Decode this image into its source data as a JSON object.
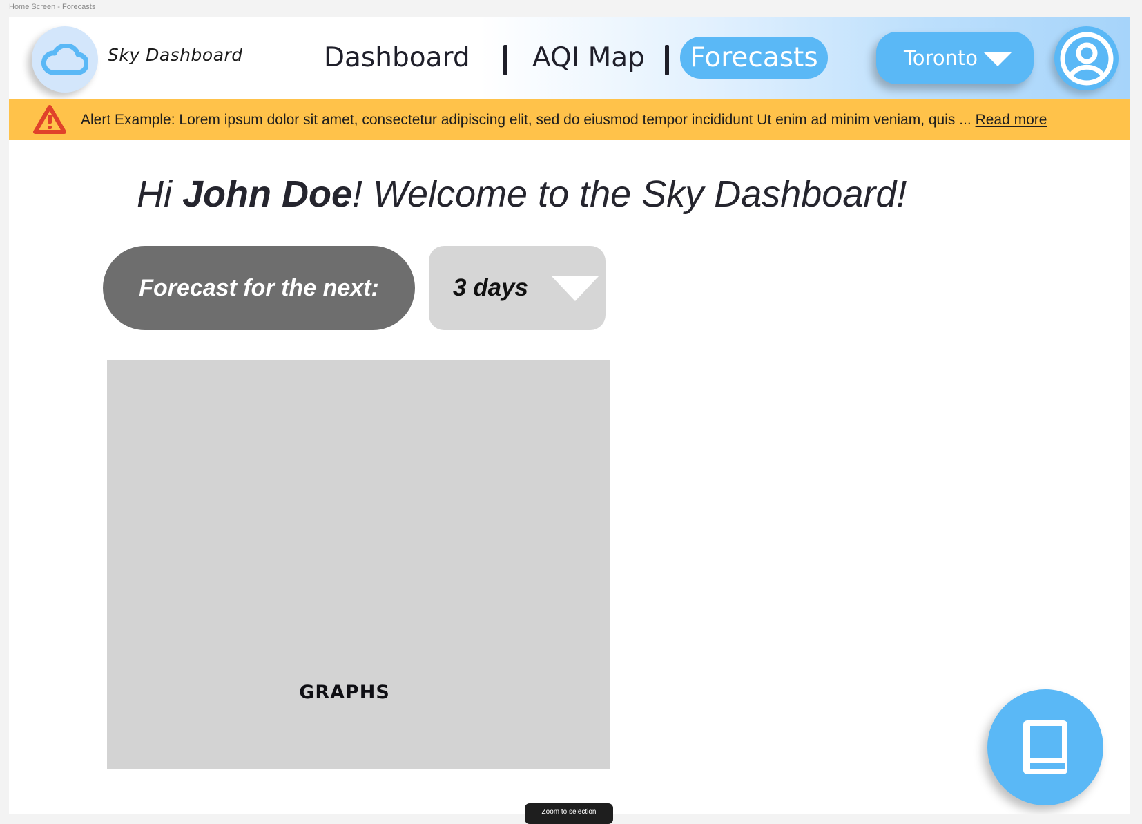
{
  "canvas": {
    "frame_label": "Home Screen - Forecasts"
  },
  "header": {
    "brand": "Sky Dashboard",
    "logo_icon": "cloud-icon",
    "nav": {
      "dashboard": "Dashboard",
      "aqi_map": "AQI Map",
      "forecasts": "Forecasts",
      "active": "Forecasts"
    },
    "city_select": {
      "value": "Toronto"
    },
    "avatar_icon": "user-profile-icon"
  },
  "alert": {
    "icon": "warning-icon",
    "text": "Alert Example: Lorem ipsum dolor sit amet, consectetur adipiscing elit, sed do eiusmod tempor incididunt Ut enim ad minim veniam, quis ... ",
    "link": "Read more"
  },
  "greeting": {
    "prefix": "Hi ",
    "name": "John Doe",
    "suffix": "! Welcome to the Sky Dashboard!"
  },
  "forecast": {
    "label": "Forecast for the next:",
    "range_value": "3 days"
  },
  "graphs": {
    "label": "GRAPHS"
  },
  "fab": {
    "icon": "book-icon"
  },
  "tooltip": {
    "text": "Zoom to selection"
  },
  "colors": {
    "accent": "#5ab8f6",
    "alert": "#ffc24a",
    "warning_icon": "#e0422a",
    "placeholder": "#d3d3d3",
    "dark_pill": "#6e6e6e"
  }
}
